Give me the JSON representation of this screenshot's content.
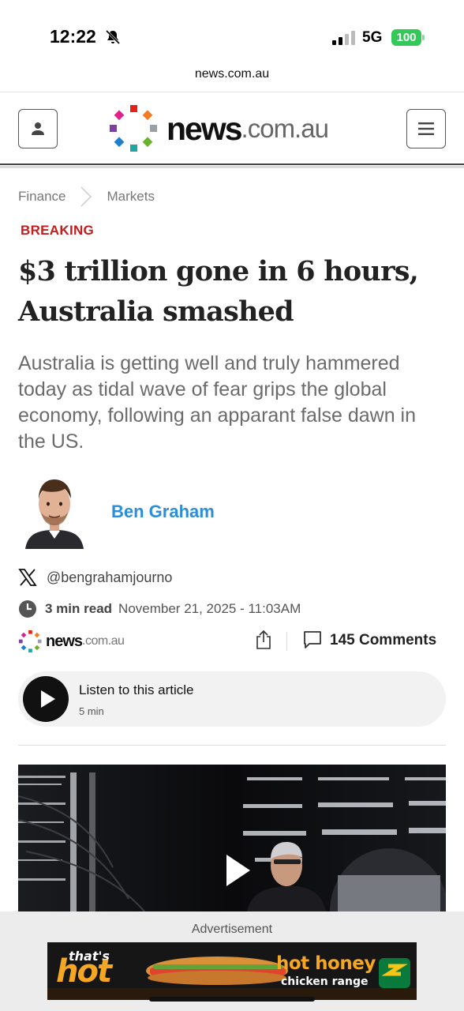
{
  "status_bar": {
    "time": "12:22",
    "network": "5G",
    "battery": "100",
    "icons": [
      "bell-slash-icon",
      "signal-bars-icon",
      "battery-icon"
    ]
  },
  "browser": {
    "url": "news.com.au"
  },
  "site": {
    "logo_word": "news",
    "logo_tld": ".com.au",
    "icons": [
      "account-icon",
      "menu-icon"
    ]
  },
  "breadcrumb": [
    "Finance",
    "Markets"
  ],
  "article": {
    "label": "BREAKING",
    "headline": "$3 trillion gone in 6 hours, Australia smashed",
    "standfirst": "Australia is getting well and truly hammered today as tidal wave of fear grips the global economy, following an apparant false dawn in the US.",
    "author": "Ben Graham",
    "twitter_handle": "@bengrahamjourno",
    "read_time": "3 min read",
    "published": "November 21, 2025 - 11:03AM",
    "comments": "145 Comments"
  },
  "share_bar": {
    "logo_word": "news",
    "logo_tld": ".com.au",
    "icons": [
      "share-icon",
      "comment-icon"
    ]
  },
  "audio_player": {
    "title": "Listen to this article",
    "duration": "5 min"
  },
  "advertisement": {
    "label": "Advertisement",
    "banner_small": "that's",
    "banner_big": "hot",
    "banner_line1": "hot honey",
    "banner_line2": "chicken range"
  },
  "colors": {
    "breaking": "#c21c1c",
    "author_link": "#2a8fd6",
    "battery": "#34c759",
    "ad_accent": "#f5a623"
  }
}
